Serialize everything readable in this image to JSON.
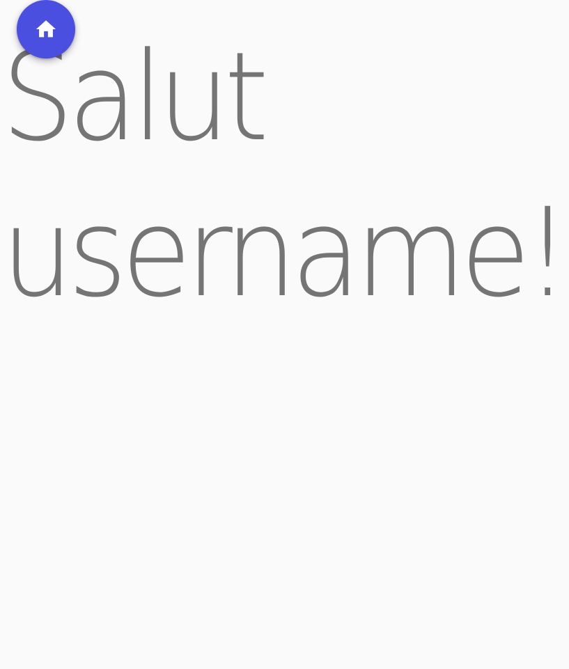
{
  "greeting": {
    "line1": "Salut",
    "line2": "username!"
  },
  "home_button": {
    "icon": "home-icon",
    "color": "#4a4fe0",
    "icon_color": "#ffffff"
  },
  "colors": {
    "background": "#fafafa",
    "text": "#757575"
  }
}
